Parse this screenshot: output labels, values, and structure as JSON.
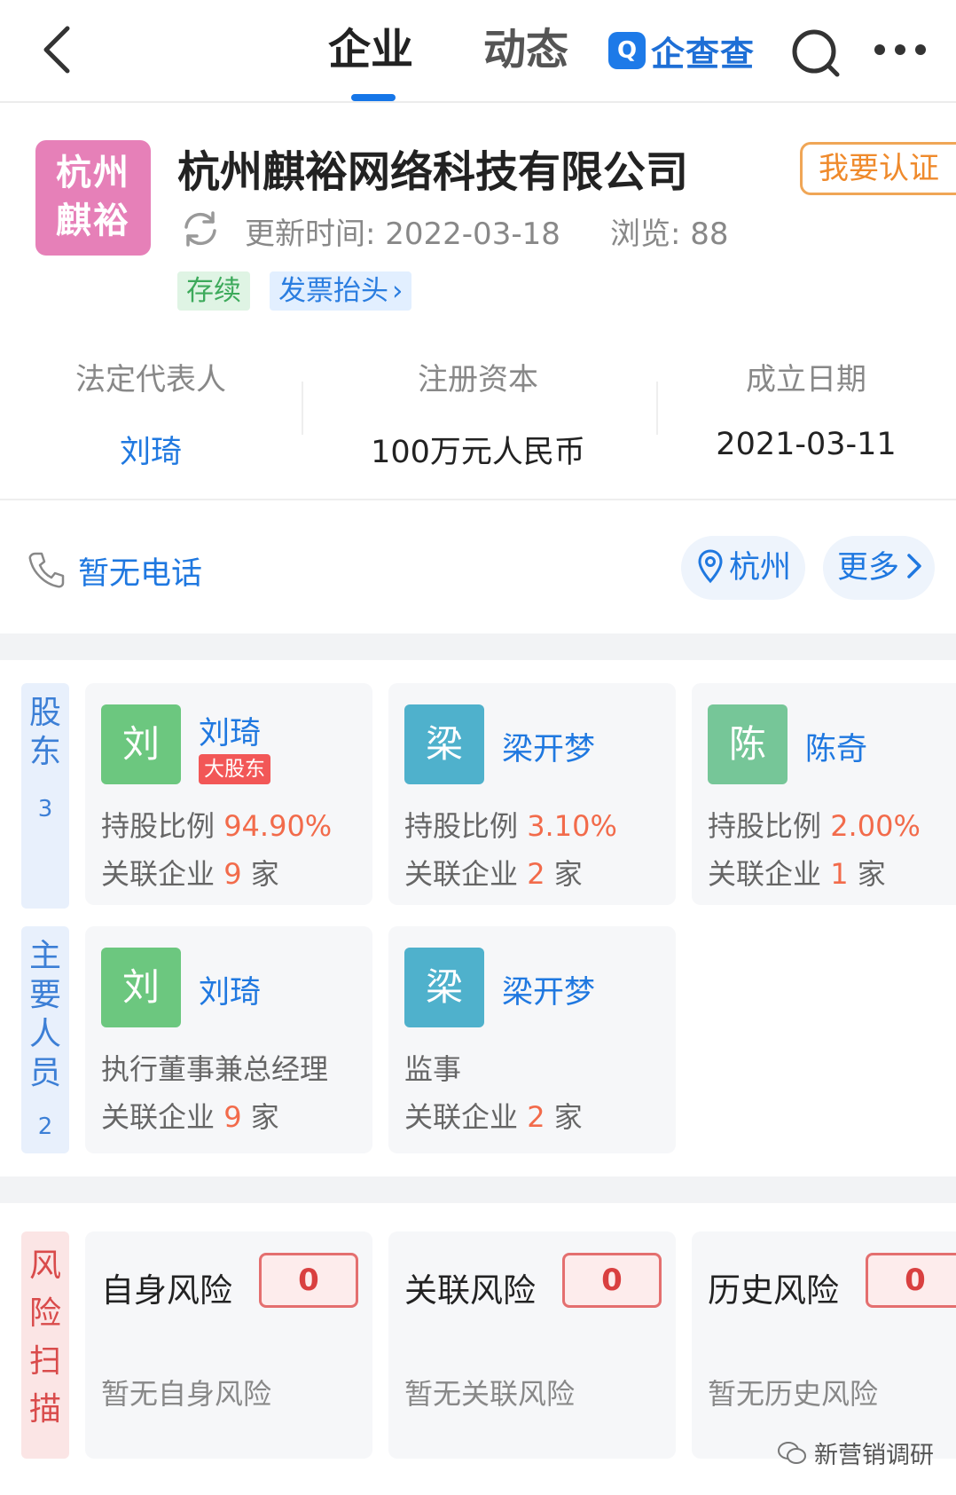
{
  "nav": {
    "tabs": [
      "企业",
      "动态"
    ],
    "brand": "企查查",
    "brand_logo": "Q"
  },
  "company": {
    "logo_lines": [
      "杭州",
      "麒裕"
    ],
    "name": "杭州麒裕网络科技有限公司",
    "certify_label": "我要认证",
    "update_time": "更新时间: 2022-03-18",
    "views": "浏览: 88",
    "tags": [
      "存续",
      "发票抬头"
    ],
    "tag_chevron": "›"
  },
  "facts": [
    {
      "label": "法定代表人",
      "value": "刘琦"
    },
    {
      "label": "注册资本",
      "value": "100万元人民币"
    },
    {
      "label": "成立日期",
      "value": "2021-03-11"
    }
  ],
  "contact": {
    "phone": "暂无电话",
    "city": "杭州",
    "more": "更多"
  },
  "shareholders": {
    "label_chars": [
      "股",
      "东"
    ],
    "count": "3",
    "items": [
      {
        "avatar": "刘",
        "name": "刘琦",
        "badge": "大股东",
        "ratio_label": "持股比例",
        "ratio": "94.90%",
        "rel_prefix": "关联企业",
        "rel_count": "9",
        "rel_suffix": "家"
      },
      {
        "avatar": "梁",
        "name": "梁开梦",
        "ratio_label": "持股比例",
        "ratio": "3.10%",
        "rel_prefix": "关联企业",
        "rel_count": "2",
        "rel_suffix": "家"
      },
      {
        "avatar": "陈",
        "name": "陈奇",
        "ratio_label": "持股比例",
        "ratio": "2.00%",
        "rel_prefix": "关联企业",
        "rel_count": "1",
        "rel_suffix": "家"
      }
    ]
  },
  "personnel": {
    "label_chars": [
      "主",
      "要",
      "人",
      "员"
    ],
    "count": "2",
    "items": [
      {
        "avatar": "刘",
        "name": "刘琦",
        "role": "执行董事兼总经理",
        "rel_prefix": "关联企业",
        "rel_count": "9",
        "rel_suffix": "家"
      },
      {
        "avatar": "梁",
        "name": "梁开梦",
        "role": "监事",
        "rel_prefix": "关联企业",
        "rel_count": "2",
        "rel_suffix": "家"
      }
    ]
  },
  "risk": {
    "label_chars": [
      "风",
      "险",
      "扫",
      "描"
    ],
    "items": [
      {
        "title": "自身风险",
        "count": "0",
        "desc": "暂无自身风险"
      },
      {
        "title": "关联风险",
        "count": "0",
        "desc": "暂无关联风险"
      },
      {
        "title": "历史风险",
        "count": "0",
        "desc": "暂无历史风险"
      }
    ]
  },
  "watermark": "新营销调研",
  "colors": {
    "accent_blue": "#1f78e0",
    "brand_blue": "#1d7ae8",
    "certify_orange": "#ef8a2c",
    "risk_red": "#d94040",
    "logo_pink": "#e680b8"
  }
}
